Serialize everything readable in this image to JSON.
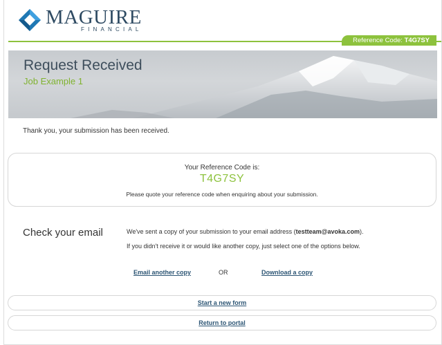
{
  "header": {
    "logo_name": "MAGUIRE",
    "logo_sub": "FINANCIAL",
    "reference_tab_prefix": "Reference Code:",
    "reference_tab_code": "T4G7SY"
  },
  "banner": {
    "title": "Request Received",
    "subtitle": "Job Example 1"
  },
  "thanks_message": "Thank you, your submission has been received.",
  "reference_box": {
    "label": "Your Reference Code is:",
    "code": "T4G7SY",
    "note": "Please quote your reference code when enquiring about your submission."
  },
  "check_email": {
    "heading": "Check your email",
    "line1_before": "We've sent a copy of your submission to your email address (",
    "email": "testteam@avoka.com",
    "line1_after": ").",
    "line2": "If you didn't receive it or would like another copy, just select one of the options below.",
    "email_another_label": "Email another copy",
    "or_label": "OR",
    "download_label": "Download a copy"
  },
  "actions": {
    "new_form_label": "Start a new form",
    "return_portal_label": "Return to portal"
  },
  "colors": {
    "accent_green": "#8dc23d",
    "brand_navy": "#2f4b63",
    "link_blue": "#2c5574"
  }
}
